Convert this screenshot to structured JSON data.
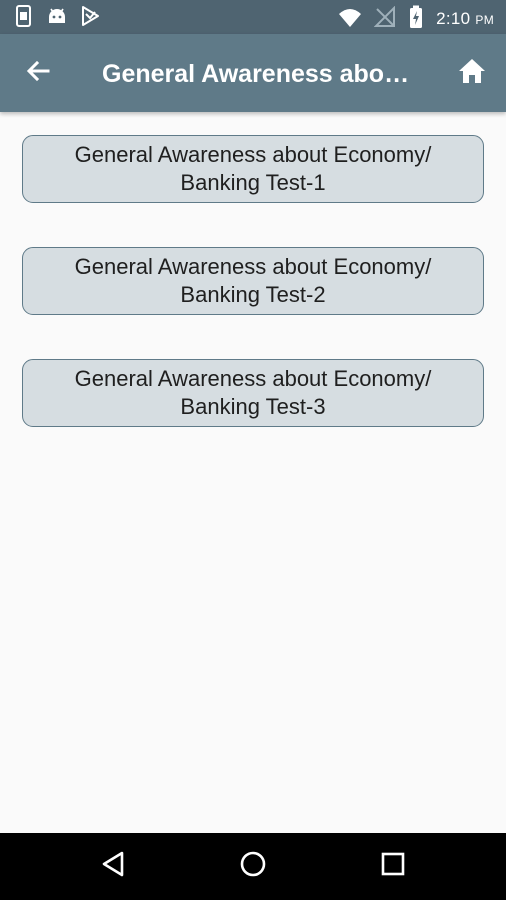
{
  "status_bar": {
    "time": "2:10",
    "ampm": "PM",
    "icons_left": [
      "phone-screenshot-icon",
      "android-icon",
      "play-store-icon"
    ],
    "icons_right": [
      "wifi-icon",
      "no-signal-icon",
      "battery-charging-icon"
    ]
  },
  "app_bar": {
    "title": "General Awareness about Economy/ Banking Test",
    "back_icon": "arrow-back-icon",
    "home_icon": "home-icon"
  },
  "tests": [
    {
      "line1": "General Awareness about Economy/",
      "line2": "Banking Test-1"
    },
    {
      "line1": "General Awareness about Economy/",
      "line2": "Banking Test-2"
    },
    {
      "line1": "General Awareness about Economy/",
      "line2": "Banking Test-3"
    }
  ],
  "nav_bar": {
    "back": "nav-back-icon",
    "home": "nav-home-icon",
    "recents": "nav-recents-icon"
  },
  "colors": {
    "status_bar": "#4f6471",
    "app_bar": "#5f7a88",
    "button_bg": "#d6dde1",
    "button_border": "#5f7a88",
    "background": "#fafafa"
  }
}
